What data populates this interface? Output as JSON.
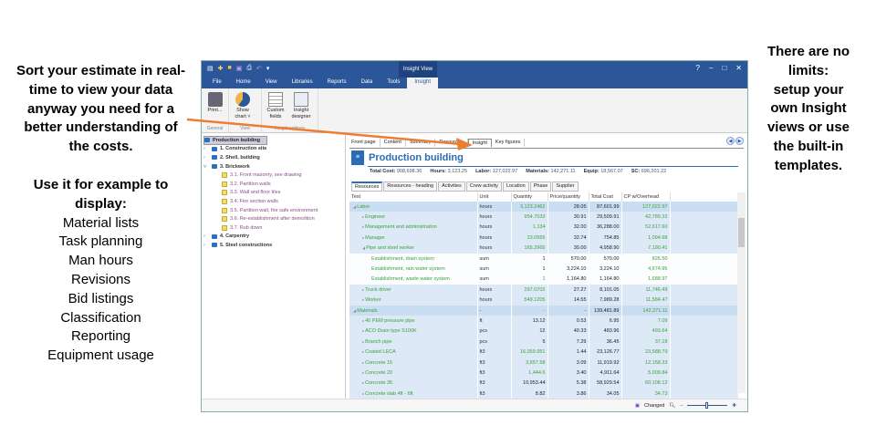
{
  "left_annotation": {
    "heading": [
      "Sort your estimate in real-",
      "time to view your data",
      "anyway you need for a",
      "better understanding of",
      "the costs."
    ],
    "subheading": [
      "Use it for example to",
      "display:"
    ],
    "items": [
      "Material lists",
      "Task planning",
      "Man hours",
      "Revisions",
      "Bid listings",
      "Classification",
      "Reporting",
      "Equipment usage"
    ]
  },
  "right_annotation": [
    "There are no",
    "limits:",
    "setup  your",
    "own Insight",
    "views or use",
    "the built-in",
    "templates."
  ],
  "window": {
    "context_tab": "Insight View",
    "menu_tabs": [
      "File",
      "Home",
      "View",
      "Libraries",
      "Reports",
      "Data",
      "Tools",
      "Insight"
    ],
    "active_menu_tab": "Insight",
    "ribbon": {
      "groups": [
        {
          "label": "General",
          "buttons": [
            "Print..."
          ]
        },
        {
          "label": "View",
          "buttons": [
            "Show chart ˅"
          ]
        },
        {
          "label": "Insight settings",
          "buttons": [
            "Custom fields",
            "Insight designer"
          ]
        }
      ]
    },
    "tree": {
      "root": "Production building",
      "items": [
        {
          "label": "1. Construction site",
          "level": 1,
          "expanded": false
        },
        {
          "label": "2. Shell, building",
          "level": 1,
          "expanded": false
        },
        {
          "label": "3. Brickwork",
          "level": 1,
          "expanded": true
        },
        {
          "label": "3.1. Front masonry, see drawing",
          "level": 2
        },
        {
          "label": "3.2. Partition walls",
          "level": 2
        },
        {
          "label": "3.3. Wall and floor tiles",
          "level": 2
        },
        {
          "label": "3.4. Fire section walls",
          "level": 2
        },
        {
          "label": "3.5. Partition wall, fire safe environment",
          "level": 2
        },
        {
          "label": "3.6. Re-establishment after demolition",
          "level": 2
        },
        {
          "label": "3.7. Rub down",
          "level": 2
        },
        {
          "label": "4. Carpentry",
          "level": 1,
          "expanded": false
        },
        {
          "label": "5. Steel constructions",
          "level": 1,
          "expanded": false
        }
      ]
    },
    "top_tabs": [
      "Front page",
      "Content",
      "Summary",
      "Resources",
      "Insight",
      "Key figures"
    ],
    "active_top_tab": "Insight",
    "page_title": "Production building",
    "summary": [
      {
        "label": "Total Cost:",
        "value": "908,698.36"
      },
      {
        "label": "Hours:",
        "value": "3,123.25"
      },
      {
        "label": "Labor:",
        "value": "127,022.97"
      },
      {
        "label": "Materials:",
        "value": "142,271.11"
      },
      {
        "label": "Equip:",
        "value": "18,567.07"
      },
      {
        "label": "SC:",
        "value": "696,201.22"
      }
    ],
    "sub_tabs": [
      "Resources",
      "Resources - heading",
      "Activities",
      "Crew activity",
      "Location",
      "Phase",
      "Supplier"
    ],
    "active_sub_tab": "Resources",
    "table": {
      "columns": [
        "Text",
        "Unit",
        "Quantity",
        "Price/quantity",
        "Total Cost",
        "CP w/Overhead"
      ],
      "rows": [
        {
          "type": "sec",
          "toggle": "◢",
          "indent": 0,
          "text": "Labor",
          "unit": "hours",
          "qty": "3,123.2462",
          "qg": true,
          "price": "28.05",
          "total": "87,601.99",
          "cp": "127,022.97"
        },
        {
          "type": "r1",
          "toggle": "▸",
          "indent": 1,
          "text": "Engineer",
          "unit": "hours",
          "qty": "954.7033",
          "qg": true,
          "price": "30.91",
          "total": "29,509.91",
          "cp": "42,789.32"
        },
        {
          "type": "r1",
          "toggle": "▸",
          "indent": 1,
          "text": "Management and administration",
          "unit": "hours",
          "qty": "1,134",
          "qg": true,
          "price": "32.00",
          "total": "36,288.00",
          "cp": "52,617.60"
        },
        {
          "type": "r1",
          "toggle": "▸",
          "indent": 1,
          "text": "Manager",
          "unit": "hours",
          "qty": "23.0555",
          "qg": true,
          "price": "32.74",
          "total": "754.85",
          "cp": "1,094.68"
        },
        {
          "type": "r1",
          "toggle": "◢",
          "indent": 1,
          "text": "Pipe and steel worker",
          "unit": "hours",
          "qty": "165.2965",
          "qg": true,
          "price": "30.00",
          "total": "4,958.90",
          "cp": "7,190.41"
        },
        {
          "type": "r2",
          "toggle": "",
          "indent": 2,
          "text": "Establishment, drain system",
          "unit": "sum",
          "qty": "1",
          "qg": false,
          "price": "570.00",
          "total": "570.00",
          "cp": "826.50"
        },
        {
          "type": "r2",
          "toggle": "",
          "indent": 2,
          "text": "Establishment, rain water system",
          "unit": "sum",
          "qty": "1",
          "qg": false,
          "price": "3,224.10",
          "total": "3,224.10",
          "cp": "4,674.95"
        },
        {
          "type": "r2",
          "toggle": "",
          "indent": 2,
          "text": "Establishment, waste water system",
          "unit": "sum",
          "qty": "1",
          "qg": true,
          "price": "1,164.80",
          "total": "1,164.80",
          "cp": "1,688.97"
        },
        {
          "type": "r1",
          "toggle": "▸",
          "indent": 1,
          "text": "Truck driver",
          "unit": "hours",
          "qty": "297.0702",
          "qg": true,
          "price": "27.27",
          "total": "8,101.05",
          "cp": "11,746.49"
        },
        {
          "type": "r1",
          "toggle": "▸",
          "indent": 1,
          "text": "Worker",
          "unit": "hours",
          "qty": "549.1205",
          "qg": true,
          "price": "14.55",
          "total": "7,989.28",
          "cp": "11,584.47"
        },
        {
          "type": "sec",
          "toggle": "◢",
          "indent": 0,
          "text": "Materials",
          "unit": "-",
          "qty": "-",
          "qg": true,
          "price": "-",
          "total": "139,481.89",
          "cp": "142,271.11"
        },
        {
          "type": "r1",
          "toggle": "▸",
          "indent": 1,
          "text": "40 PEM pressure pipe",
          "unit": "ft",
          "qty": "13.12",
          "qg": false,
          "price": "0.53",
          "total": "6.95",
          "cp": "7.09"
        },
        {
          "type": "r1",
          "toggle": "▸",
          "indent": 1,
          "text": "ACO Drain type S100K",
          "unit": "pcs",
          "qty": "12",
          "qg": false,
          "price": "40.33",
          "total": "483.96",
          "cp": "493.64"
        },
        {
          "type": "r1",
          "toggle": "▸",
          "indent": 1,
          "text": "Branch pipe",
          "unit": "pcs",
          "qty": "5",
          "qg": false,
          "price": "7.29",
          "total": "36.45",
          "cp": "37.18"
        },
        {
          "type": "r1",
          "toggle": "▸",
          "indent": 1,
          "text": "Coated LECA",
          "unit": "ft3",
          "qty": "16,059.951",
          "qg": true,
          "price": "1.44",
          "total": "23,126.77",
          "cp": "23,588.79"
        },
        {
          "type": "r1",
          "toggle": "▸",
          "indent": 1,
          "text": "Concrete 15",
          "unit": "ft3",
          "qty": "3,857.58",
          "qg": true,
          "price": "3.09",
          "total": "11,919.92",
          "cp": "12,158.33"
        },
        {
          "type": "r1",
          "toggle": "▸",
          "indent": 1,
          "text": "Concrete 20",
          "unit": "ft3",
          "qty": "1,444.6",
          "qg": true,
          "price": "3.40",
          "total": "4,911.64",
          "cp": "5,009.84"
        },
        {
          "type": "r1",
          "toggle": "▸",
          "indent": 1,
          "text": "Concrete 35",
          "unit": "ft3",
          "qty": "10,953.44",
          "qg": false,
          "price": "5.38",
          "total": "58,929.54",
          "cp": "60,108.12"
        },
        {
          "type": "r1",
          "toggle": "▸",
          "indent": 1,
          "text": "Concrete slab 4ft - 6ft",
          "unit": "ft3",
          "qty": "8.82",
          "qg": false,
          "price": "3.86",
          "total": "34.05",
          "cp": "34.73"
        }
      ]
    },
    "status": {
      "changed_label": "Changed",
      "zoom_level": 0.5
    }
  },
  "colors": {
    "brand_blue": "#2b579a",
    "title_blue": "#2b6cb7",
    "green": "#3aa23a",
    "arrow": "#ed7d31"
  }
}
